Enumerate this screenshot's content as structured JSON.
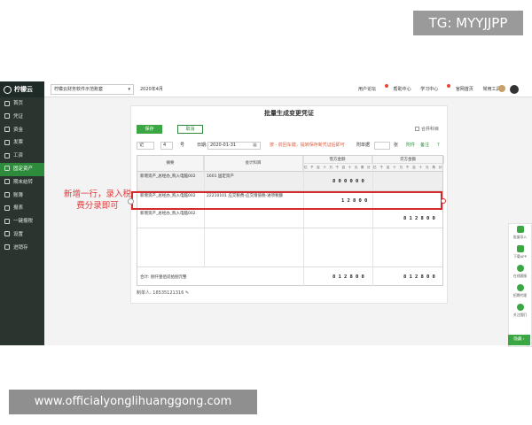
{
  "watermarks": {
    "top": "TG: MYYJJPP",
    "bottom": "www.officialyonglihuanggong.com"
  },
  "app": {
    "logo": "柠檬云",
    "company": "柠檬云财务软件示范账套",
    "period": "2020年4月",
    "topnav": [
      "用户论坛",
      "帮助中心",
      "学习中心",
      "官网首页",
      "常用工具 ▾"
    ]
  },
  "sidebar": {
    "items": [
      {
        "label": "首页",
        "icon": "home-icon"
      },
      {
        "label": "凭证",
        "icon": "voucher-icon"
      },
      {
        "label": "资金",
        "icon": "fund-icon"
      },
      {
        "label": "发票",
        "icon": "invoice-icon"
      },
      {
        "label": "工资",
        "icon": "salary-icon"
      },
      {
        "label": "固定资产",
        "icon": "asset-icon",
        "active": true
      },
      {
        "label": "期末结转",
        "icon": "period-end-icon"
      },
      {
        "label": "账簿",
        "icon": "ledger-icon"
      },
      {
        "label": "报表",
        "icon": "report-icon"
      },
      {
        "label": "一键报税",
        "icon": "tax-icon"
      },
      {
        "label": "设置",
        "icon": "settings-icon"
      },
      {
        "label": "进销存",
        "icon": "inventory-icon"
      }
    ]
  },
  "panel": {
    "title": "批量生成变更凭证",
    "save": "保存",
    "cancel": "取消",
    "merge_label": "合并科目",
    "voucher_word": "记",
    "voucher_no": "4",
    "no_label": "号",
    "date_label": "日期:",
    "date_value": "2020-01-31",
    "tip": "按 · 前回车键，提转保存新凭证后即可",
    "attachments_label": "附单据",
    "attachments_unit": "张",
    "attach_link": "附件",
    "note_link": "备注",
    "help": "?"
  },
  "table": {
    "headers": {
      "summary": "摘要",
      "account": "会计科目",
      "debit": "借方金额",
      "credit": "贷方金额"
    },
    "digit_heads": [
      "亿",
      "千",
      "百",
      "十",
      "万",
      "千",
      "百",
      "十",
      "元",
      "角",
      "分"
    ],
    "rows": [
      {
        "summary": "新增资产_总经办_购入电脑002",
        "account": "1601 固定资产",
        "debit": "800000",
        "credit": ""
      },
      {
        "summary": "新增资产_总经办_购入电脑002",
        "account": "22210101 应交税费-应交增值税-进项税额",
        "debit": "12800",
        "credit": ""
      },
      {
        "summary": "新增资产_总经办_购入电脑002",
        "account": "",
        "debit": "",
        "credit": "812800"
      },
      {
        "summary": "",
        "account": "",
        "debit": "",
        "credit": ""
      }
    ],
    "total_label": "合计: 捌仟壹佰贰拾捌元整",
    "total_debit": "812800",
    "total_credit": "812800"
  },
  "maker": "制单人: 18535121316",
  "annotation": "新增一行，录入税费分录即可",
  "right_tools": [
    {
      "label": "批量导入",
      "icon": "download-icon"
    },
    {
      "label": "下载APP",
      "icon": "app-icon"
    },
    {
      "label": "在线客服",
      "icon": "service-icon"
    },
    {
      "label": "招聘代理",
      "icon": "recruit-icon"
    },
    {
      "label": "关注我们",
      "icon": "wechat-icon"
    }
  ],
  "right_more": "隐藏 ›",
  "colors": {
    "brand_green": "#3aa743",
    "sidebar_bg": "#2b3530",
    "highlight_red": "#d42a2a"
  }
}
